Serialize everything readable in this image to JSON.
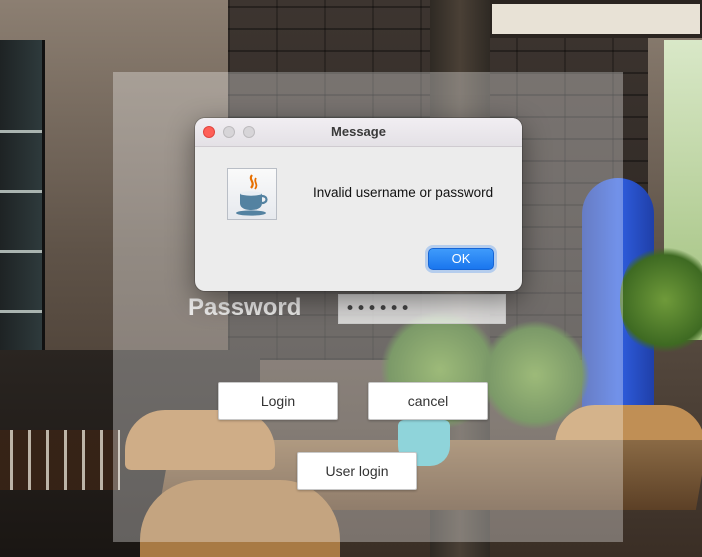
{
  "login": {
    "password_label": "Password",
    "password_masked": "••••••",
    "login_button": "Login",
    "cancel_button": "cancel",
    "user_login_button": "User login"
  },
  "dialog": {
    "title": "Message",
    "message": "Invalid username or password",
    "ok_button": "OK",
    "icon": "java-icon"
  },
  "colors": {
    "ok_button": "#1a76ee",
    "close_light": "#fe5f57",
    "dialog_bg": "#ececec"
  }
}
